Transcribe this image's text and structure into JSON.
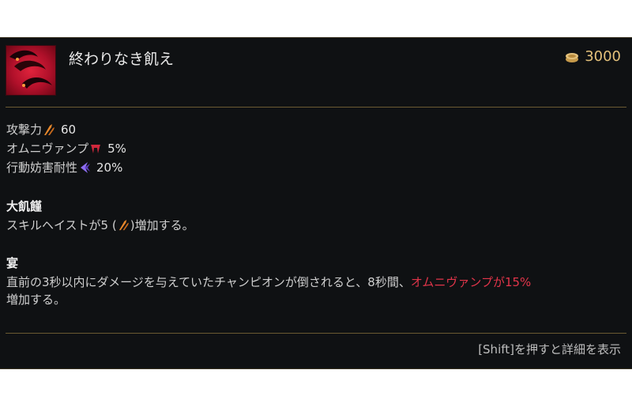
{
  "item": {
    "name": "終わりなき飢え",
    "cost": "3000"
  },
  "stats": [
    {
      "label": "攻撃力",
      "icon": "attack-damage-icon",
      "value": "60"
    },
    {
      "label": "オムニヴァンプ",
      "icon": "omnivamp-icon",
      "value": "5%"
    },
    {
      "label": "行動妨害耐性",
      "icon": "tenacity-icon",
      "value": "20%"
    }
  ],
  "passives": [
    {
      "title": "大飢饉",
      "text_before": "スキルヘイストが5 (",
      "text_after": ")増加する。"
    },
    {
      "title": "宴",
      "line1_before": "直前の3秒以内にダメージを与えていたチャンピオンが倒されると、8秒間、",
      "line1_highlight": "オムニヴァンプが15%",
      "line2": "増加する。"
    }
  ],
  "footer": "[Shift]を押すと詳細を表示",
  "colors": {
    "highlight": "#e2354a",
    "gold": "#e3c07a",
    "divider": "#6b5a32"
  }
}
